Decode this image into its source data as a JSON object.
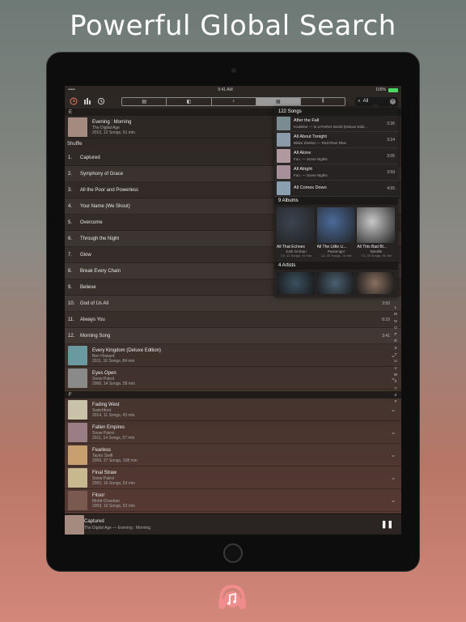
{
  "headline": "Powerful Global Search",
  "status": {
    "carrier": "••••• ",
    "time": "9:41 AM",
    "battery": "100%"
  },
  "toolbar": {
    "segments": [
      "album-tab",
      "book-tab",
      "music-note-tab",
      "grid-tab",
      "equalizer-tab"
    ],
    "active_segment": 3,
    "search_value": "All"
  },
  "library": {
    "section_e": "E",
    "albums_top": [
      {
        "title": "Evening : Morning",
        "artist": "The Digital Age",
        "meta": "2012, 12 Songs, 51 min",
        "color": "#a58a80"
      }
    ],
    "shuffle": "Shuffle",
    "tracks": [
      {
        "n": "1.",
        "title": "Captured",
        "dur": ""
      },
      {
        "n": "2.",
        "title": "Symphony of Grace",
        "dur": ""
      },
      {
        "n": "3.",
        "title": "All the Poor and Powerless",
        "dur": ""
      },
      {
        "n": "4.",
        "title": "Your Name (We Shout)",
        "dur": ""
      },
      {
        "n": "5.",
        "title": "Overcome",
        "dur": ""
      },
      {
        "n": "6.",
        "title": "Through the Night",
        "dur": ""
      },
      {
        "n": "7.",
        "title": "Glow",
        "dur": ""
      },
      {
        "n": "8.",
        "title": "Break Every Chain",
        "dur": ""
      },
      {
        "n": "9.",
        "title": "Believe",
        "dur": ""
      },
      {
        "n": "10.",
        "title": "God of Us All",
        "dur": "3:50"
      },
      {
        "n": "11.",
        "title": "Always You",
        "dur": "6:15"
      },
      {
        "n": "12.",
        "title": "Morning Song",
        "dur": "3:41"
      }
    ],
    "albums_e": [
      {
        "title": "Every Kingdom (Deluxe Edition)",
        "artist": "Ben Howard",
        "meta": "2011, 16 Songs, 84 min",
        "color": "#6a9aa0"
      },
      {
        "title": "Eyes Open",
        "artist": "Snow Patrol",
        "meta": "2006, 14 Songs, 58 min",
        "color": "#8a8a8a"
      }
    ],
    "section_f": "F",
    "albums_f": [
      {
        "title": "Fading West",
        "artist": "Switchfoot",
        "meta": "2014, 11 Songs, 43 min",
        "color": "#c8c2a8"
      },
      {
        "title": "Fallen Empires",
        "artist": "Snow Patrol",
        "meta": "2011, 14 Songs, 57 min",
        "color": "#9a7e86"
      },
      {
        "title": "Fearless",
        "artist": "Taylor Swift",
        "meta": "2009, 27 Songs, 108 min",
        "color": "#c8a070"
      },
      {
        "title": "Final Straw",
        "artist": "Snow Patrol",
        "meta": "2003, 16 Songs, 53 min",
        "color": "#c8b890"
      },
      {
        "title": "Fitoor",
        "artist": "Mohit Chauhan",
        "meta": "2009, 10 Songs, 62 min",
        "color": "#7a5a50"
      }
    ]
  },
  "results": {
    "songs_header": "122 Songs",
    "songs": [
      {
        "title": "After the Fall",
        "sub": "Kodaline  —  In a Perfect World (Deluxe Editi...",
        "dur": "3:36",
        "color": "#7a8c90"
      },
      {
        "title": "All About Tonight",
        "sub": "Blake Shelton  —  Red River Blue",
        "dur": "3:24",
        "color": "#8a9aa8"
      },
      {
        "title": "All Alone",
        "sub": "Fun.  —  Some Nights",
        "dur": "3:05",
        "color": "#b09aa0"
      },
      {
        "title": "All Alright",
        "sub": "Fun.  —  Some Nights",
        "dur": "3:59",
        "color": "#a8909a"
      },
      {
        "title": "All Comes Down",
        "sub": "",
        "dur": "4:55",
        "color": "#8aa0b0"
      }
    ],
    "albums_header": "9 Albums",
    "albums": [
      {
        "title": "All That Echoes",
        "artist": "Josh Groban",
        "meta": "'13, 12 Songs, 51 min",
        "color": "#3a4450"
      },
      {
        "title": "All The Little Li...",
        "artist": "Passenger",
        "meta": "'12, 20 Songs, 74 min",
        "color": "#4a6a9a"
      },
      {
        "title": "All This Bad Bl...",
        "artist": "Bastille",
        "meta": "'13, 28 Songs, 91 min",
        "color": "#c8c8c8"
      }
    ],
    "artists_header": "4 Artists",
    "artists": [
      "#3a5060",
      "#4a6070",
      "#8a7060"
    ]
  },
  "index_letters": [
    "L",
    "M",
    "N",
    "O",
    "P",
    "R",
    "S",
    "T",
    "U",
    "V",
    "W",
    "X",
    "Y",
    "Z",
    "#"
  ],
  "now_playing": {
    "title": "Captured",
    "subtitle": "The Digital Age  —  Evening : Morning"
  },
  "colors": {
    "accent": "#e8785a",
    "logo": "#f08c8c"
  }
}
